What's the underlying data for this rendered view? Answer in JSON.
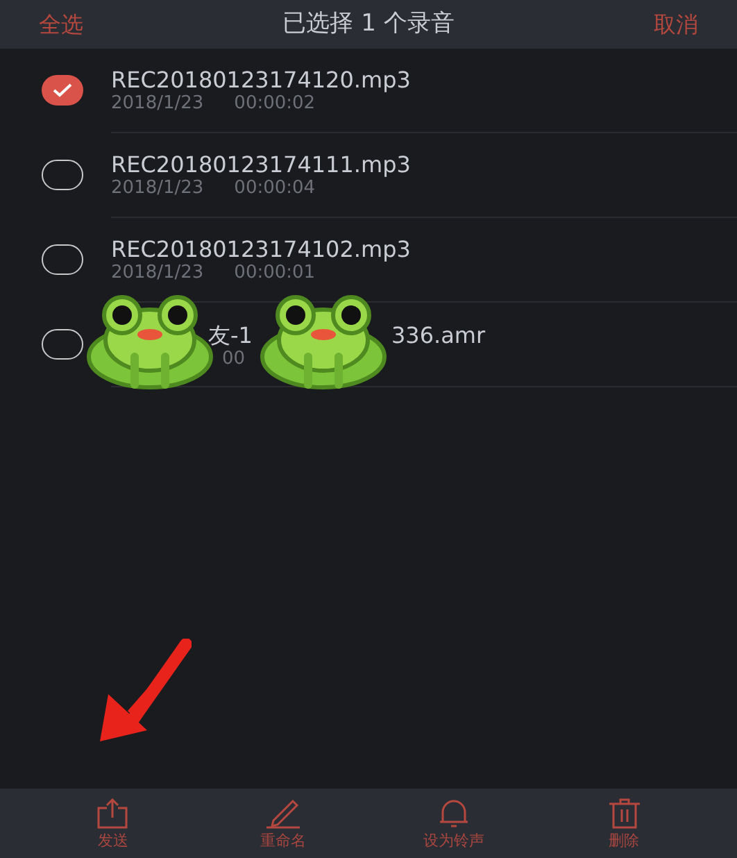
{
  "header": {
    "select_all": "全选",
    "title": "已选择 1 个录音",
    "cancel": "取消"
  },
  "recordings": [
    {
      "kind": "plain",
      "name": "REC20180123174120.mp3",
      "date": "2018/1/23",
      "duration": "00:00:02",
      "selected": true
    },
    {
      "kind": "plain",
      "name": "REC20180123174111.mp3",
      "date": "2018/1/23",
      "duration": "00:00:04",
      "selected": false
    },
    {
      "kind": "plain",
      "name": "REC20180123174102.mp3",
      "date": "2018/1/23",
      "duration": "00:00:01",
      "selected": false
    },
    {
      "kind": "covered",
      "name_parts": [
        "友-1",
        "336.amr"
      ],
      "date_part": "00",
      "selected": false
    }
  ],
  "toolbar": [
    {
      "kind": "share",
      "label": "发送"
    },
    {
      "kind": "pencil",
      "label": "重命名"
    },
    {
      "kind": "bell",
      "label": "设为铃声"
    },
    {
      "kind": "trash",
      "label": "删除"
    }
  ]
}
